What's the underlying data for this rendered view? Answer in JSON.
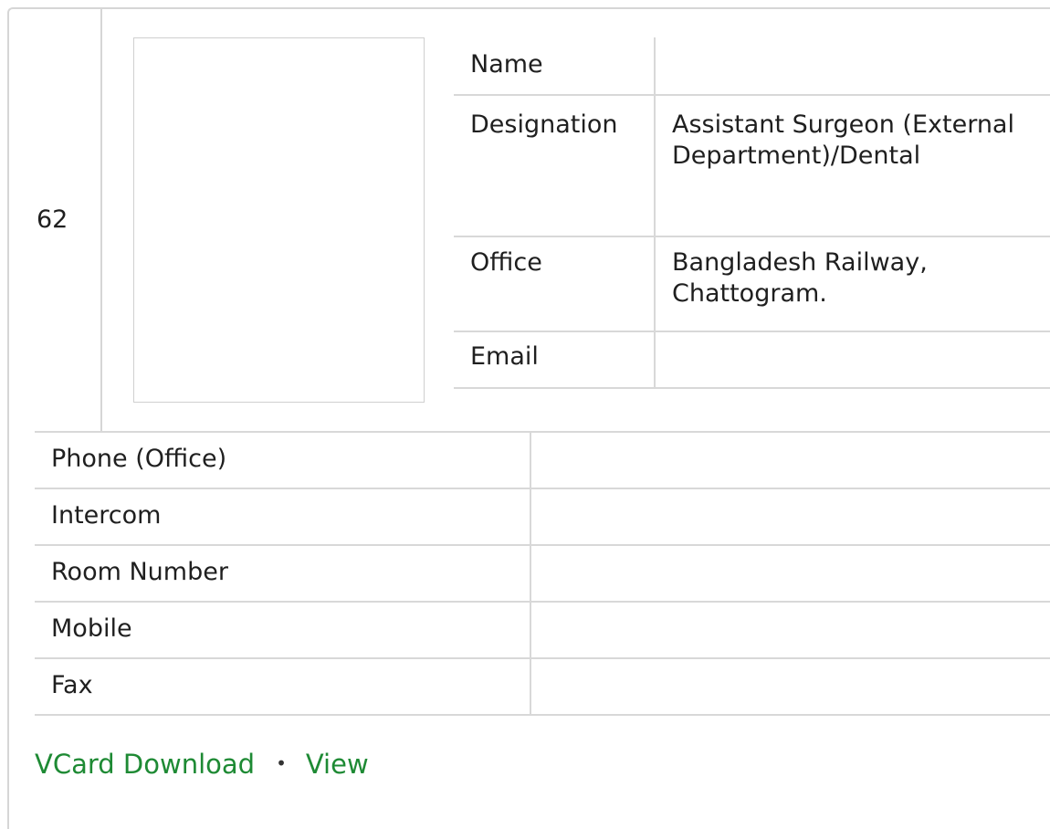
{
  "entry": {
    "serial": "62",
    "fields": {
      "name_label": "Name",
      "name_value": "",
      "designation_label": "Designation",
      "designation_value": "Assistant Surgeon (External Department)/Dental",
      "office_label": "Office",
      "office_value": "Bangladesh Railway, Chattogram.",
      "email_label": "Email",
      "email_value": ""
    },
    "contact": [
      {
        "label": "Phone (Office)",
        "value": ""
      },
      {
        "label": "Intercom",
        "value": ""
      },
      {
        "label": "Room Number",
        "value": ""
      },
      {
        "label": "Mobile",
        "value": ""
      },
      {
        "label": "Fax",
        "value": ""
      }
    ]
  },
  "links": {
    "vcard_label": "VCard Download",
    "separator": "•",
    "view_label": "View"
  },
  "colors": {
    "link": "#1e8a34",
    "border": "#d8d8d8"
  }
}
